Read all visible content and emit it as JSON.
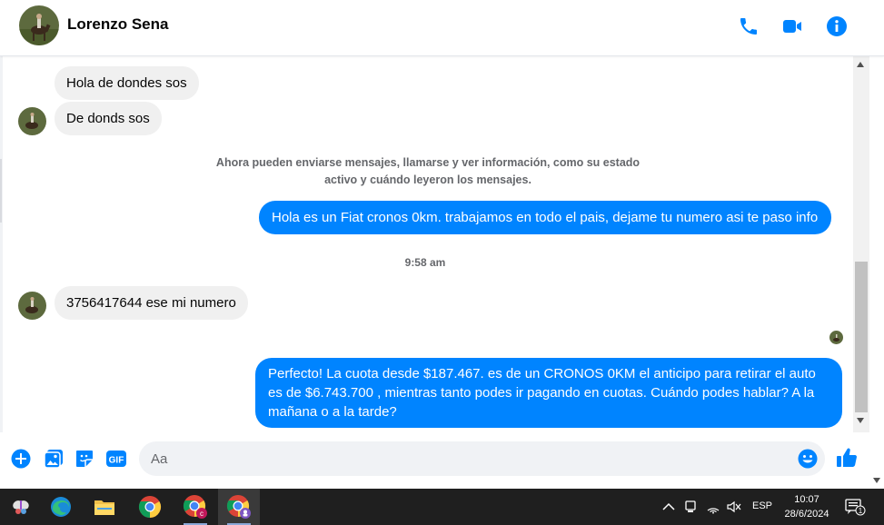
{
  "header": {
    "contact_name": "Lorenzo Sena"
  },
  "colors": {
    "accent": "#0084ff",
    "incoming_bubble": "#f0f0f0",
    "taskbar": "#1f1f1f"
  },
  "icons": {
    "header": [
      "phone-icon",
      "video-icon",
      "info-icon"
    ],
    "composer": [
      "plus-icon",
      "image-icon",
      "sticker-icon",
      "gif-icon",
      "emoji-icon",
      "like-icon"
    ]
  },
  "messages": {
    "in1": "Hola de dondes sos",
    "in2": "De donds sos",
    "notice_line1": "Ahora pueden enviarse mensajes, llamarse y ver información, como su estado",
    "notice_line2": "activo y cuándo leyeron los mensajes.",
    "out1": "Hola es un Fiat cronos 0km. trabajamos en todo el pais, dejame tu numero asi te paso info",
    "timestamp": "9:58 am",
    "in3": "3756417644 ese mi numero",
    "out2_line1": "Perfecto! La cuota desde $187.467. es de un CRONOS 0KM el anticipo para retirar el auto",
    "out2_line2": "es de $6.743.700 , mientras tanto podes ir pagando en cuotas. Cuándo podes hablar? A la",
    "out2_line3": "mañana o a la tarde?"
  },
  "composer": {
    "gif_label": "GIF",
    "placeholder": "Aa",
    "value": ""
  },
  "taskbar": {
    "apps": [
      "app-icon",
      "edge-icon",
      "file-explorer-icon",
      "chrome-icon",
      "chrome-profile-icon",
      "chrome-profile-icon"
    ],
    "language": "ESP",
    "time": "10:07",
    "date": "28/6/2024",
    "notification_count": "1"
  }
}
